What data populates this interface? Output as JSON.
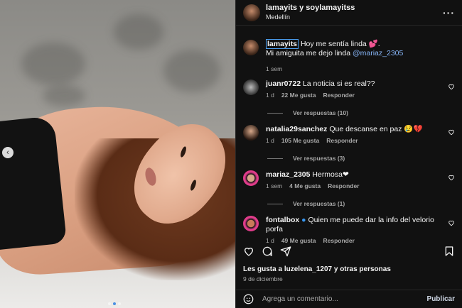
{
  "post": {
    "header": {
      "username": "lamayits y soylamayitss",
      "location": "Medellín",
      "more_icon": "more-dots-icon"
    },
    "caption": {
      "username": "lamayits",
      "line1": "Hoy me sentía linda 💕.",
      "line2_prefix": "Mi amiguita me dejo linda ",
      "mention": "@mariaz_2305",
      "time": "1 sem"
    },
    "comments": [
      {
        "username": "juanr0722",
        "text": "La noticia si es real??",
        "time": "1 d",
        "likes": "22 Me gusta",
        "reply": "Responder",
        "view_replies": "Ver respuestas (10)"
      },
      {
        "username": "natalia29sanchez",
        "text": "Que descanse en paz 😢💔",
        "time": "1 d",
        "likes": "105 Me gusta",
        "reply": "Responder",
        "view_replies": "Ver respuestas (3)"
      },
      {
        "username": "mariaz_2305",
        "text": "Hermosa❤",
        "time": "1 sem",
        "likes": "4 Me gusta",
        "reply": "Responder",
        "view_replies": "Ver respuestas (1)"
      },
      {
        "username": "fontalbox",
        "text": "Quien me puede dar la info del velorio porfa",
        "time": "1 d",
        "likes": "49 Me gusta",
        "reply": "Responder"
      }
    ],
    "likes_prefix": "Les gusta a ",
    "likes_user": "luzelena_1207",
    "likes_suffix": " y otras personas",
    "date": "9 de diciembre",
    "add_comment_placeholder": "Agrega un comentario...",
    "publish_label": "Publicar",
    "carousel": {
      "total": 3,
      "current": 2
    }
  },
  "colors": {
    "background": "#111111",
    "link": "#86b4f5",
    "muted": "#a8a8a8",
    "carousel_active": "#4a90e2"
  }
}
